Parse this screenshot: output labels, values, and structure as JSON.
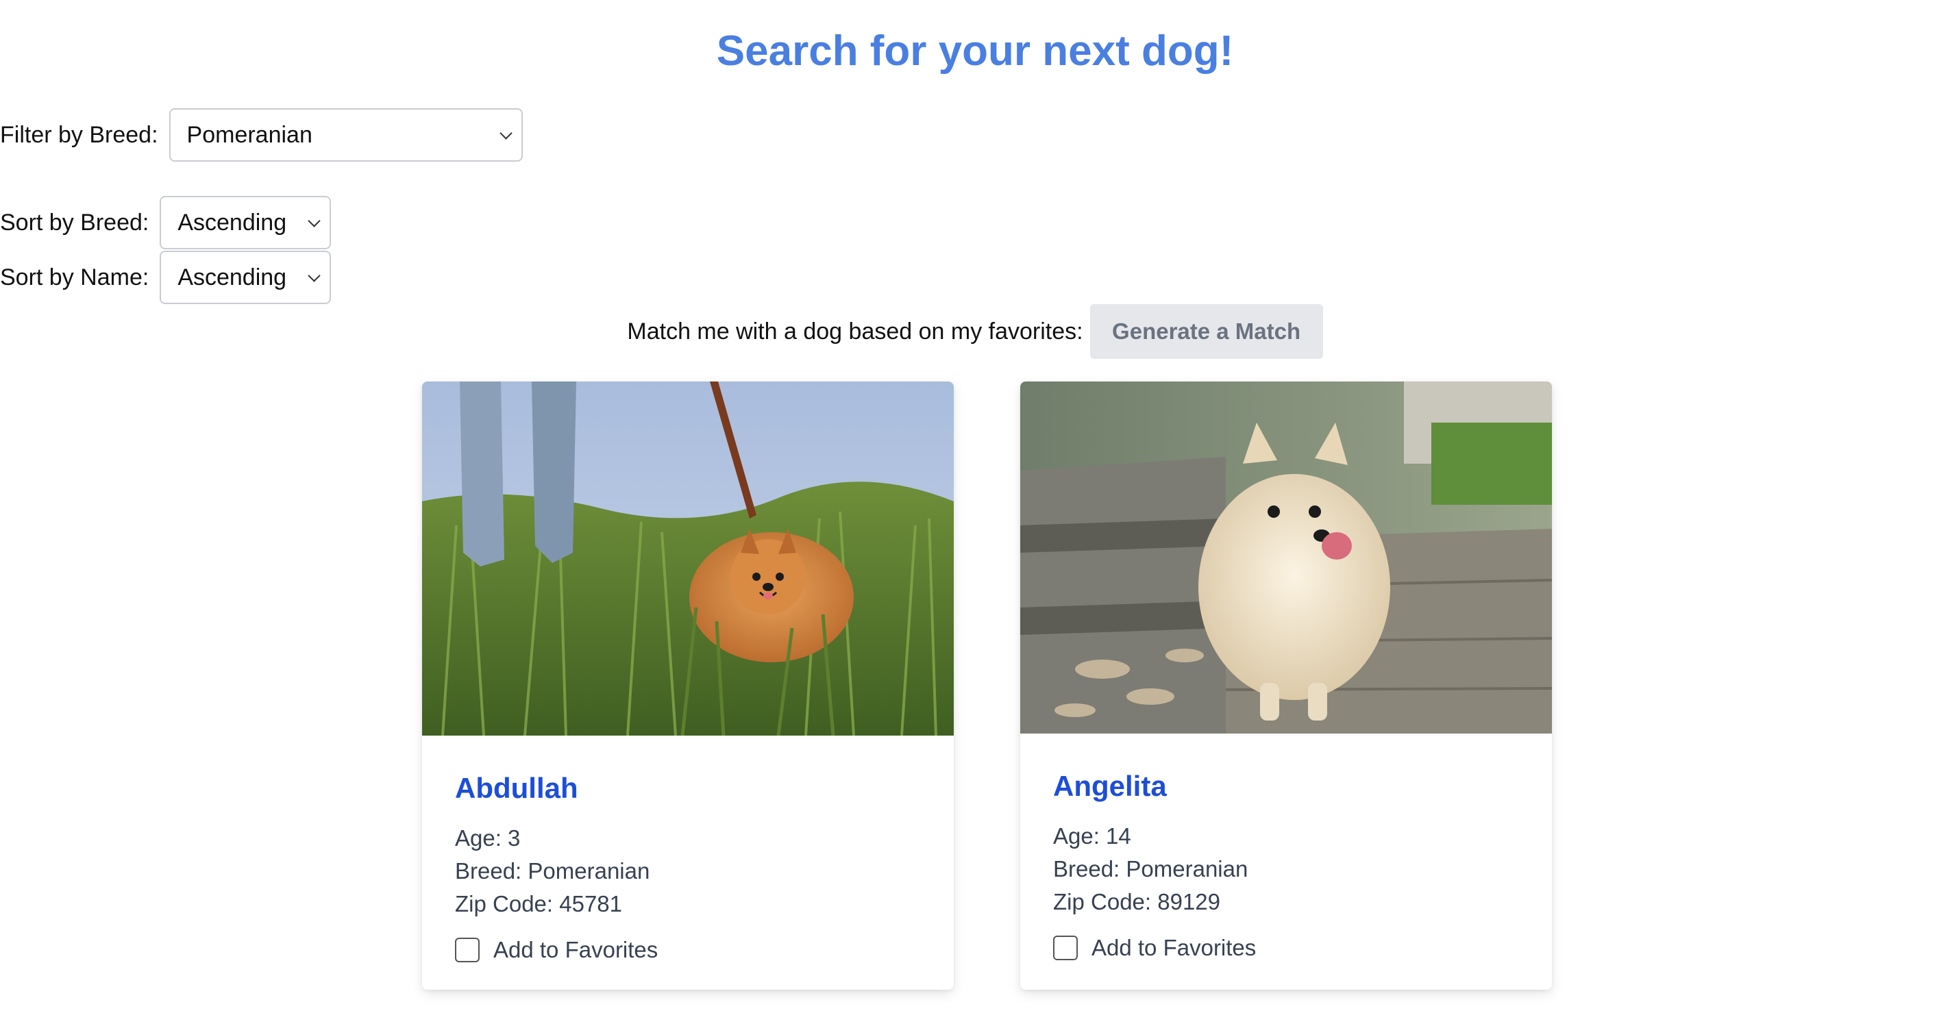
{
  "page": {
    "title": "Search for your next dog!"
  },
  "filters": {
    "breed_label": "Filter by Breed:",
    "breed_value": "Pomeranian",
    "sort_breed_label": "Sort by Breed:",
    "sort_breed_value": "Ascending",
    "sort_name_label": "Sort by Name:",
    "sort_name_value": "Ascending"
  },
  "match": {
    "label": "Match me with a dog based on my favorites:",
    "button_label": "Generate a Match"
  },
  "dogs": [
    {
      "name": "Abdullah",
      "age": "Age: 3",
      "breed": "Breed: Pomeranian",
      "zip": "Zip Code: 45781",
      "favorite_label": "Add to Favorites",
      "favorite_checked": false
    },
    {
      "name": "Angelita",
      "age": "Age: 14",
      "breed": "Breed: Pomeranian",
      "zip": "Zip Code: 89129",
      "favorite_label": "Add to Favorites",
      "favorite_checked": false
    }
  ],
  "colors": {
    "title": "#4a7fe2",
    "dog_name": "#1d4ed8",
    "button_bg": "#e5e7eb",
    "button_text": "#6b7280"
  }
}
